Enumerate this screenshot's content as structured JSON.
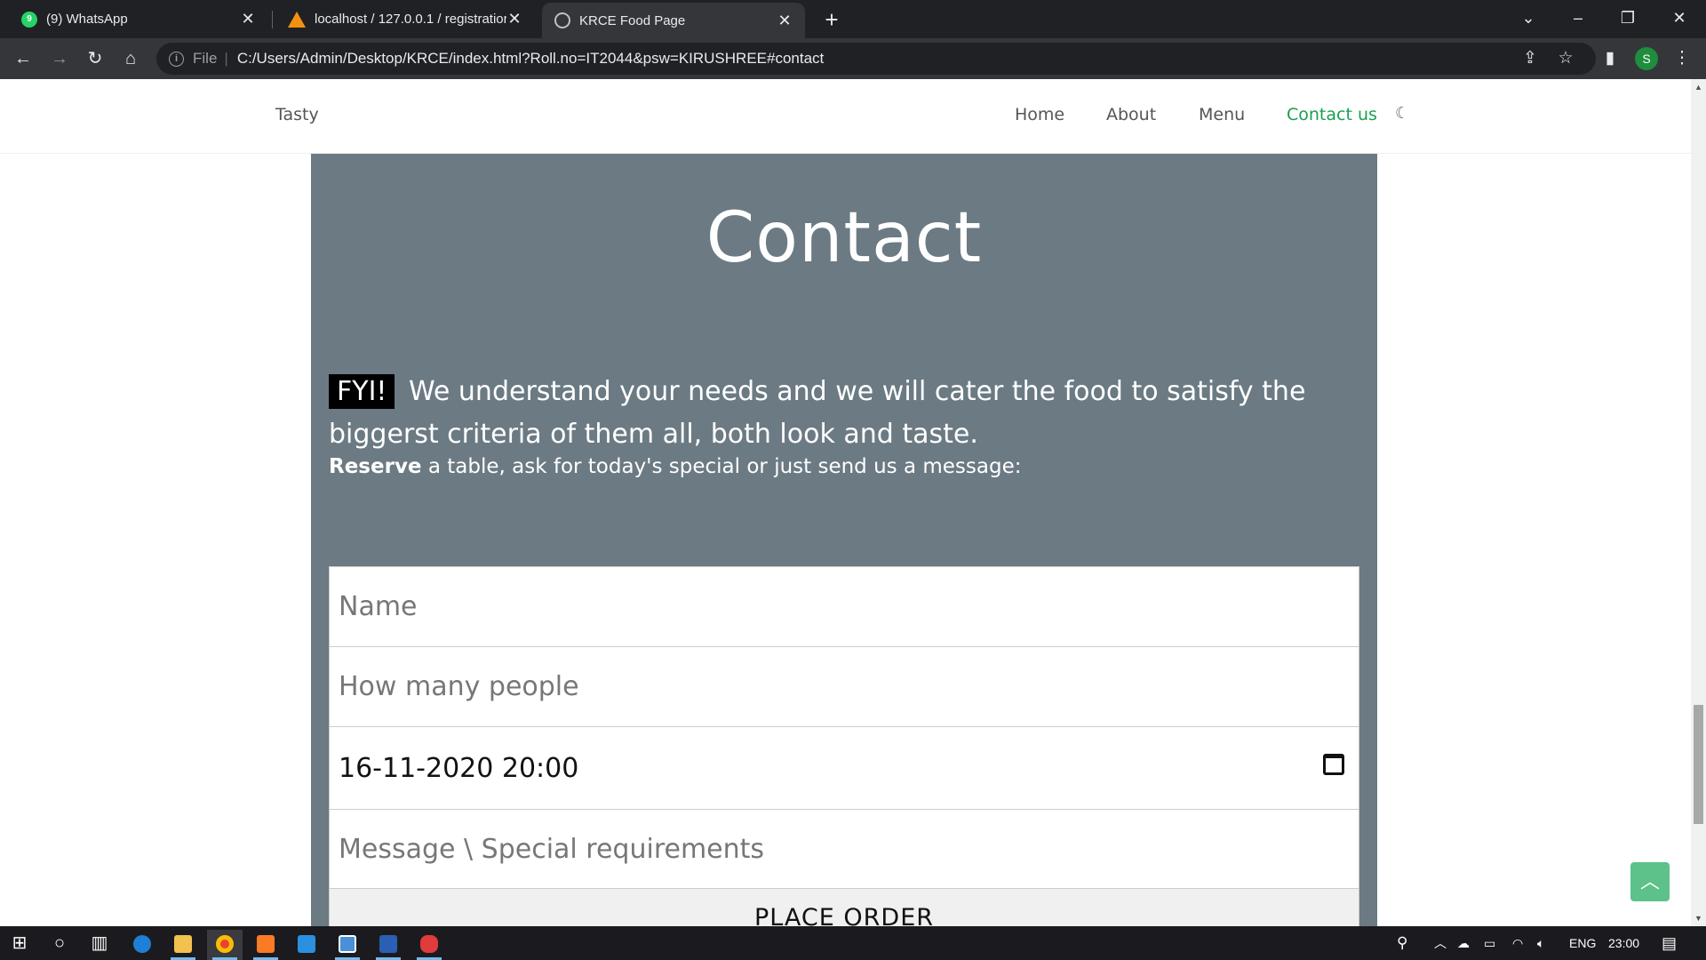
{
  "browser": {
    "tabs": [
      {
        "title": "(9) WhatsApp",
        "favicon": "whatsapp-icon",
        "badge": "9"
      },
      {
        "title": "localhost / 127.0.0.1 / registratior",
        "favicon": "phpmyadmin-icon"
      },
      {
        "title": "KRCE Food Page",
        "favicon": "globe-icon"
      }
    ],
    "address": {
      "scheme_label": "File",
      "url": "C:/Users/Admin/Desktop/KRCE/index.html?Roll.no=IT2044&psw=KIRUSHREE#contact"
    },
    "profile_initial": "S"
  },
  "site": {
    "brand": "Tasty",
    "nav": [
      "Home",
      "About",
      "Menu",
      "Contact us"
    ],
    "active_nav": "Contact us",
    "accent_color": "#1a9e52"
  },
  "contact": {
    "heading": "Contact",
    "fyi_badge": "FYI!",
    "lead": "We understand your needs and we will cater the food to satisfy the biggerst criteria of them all, both look and taste.",
    "sub_bold": "Reserve",
    "sub_rest": " a table, ask for today's special or just send us a message:",
    "fields": {
      "name_placeholder": "Name",
      "people_placeholder": "How many people",
      "datetime_value": "16-11-2020 20:00",
      "message_placeholder": "Message \\ Special requirements"
    },
    "submit_label": "PLACE ORDER",
    "panel_color": "#6b7a83"
  },
  "taskbar": {
    "language": "ENG",
    "time": "23:00",
    "apps": [
      "start-icon",
      "cortana-icon",
      "task-view-icon",
      "edge-icon",
      "file-explorer-icon",
      "chrome-icon",
      "xampp-icon",
      "vscode-icon",
      "devcpp-icon",
      "word-icon",
      "notepad-plus-icon"
    ]
  }
}
